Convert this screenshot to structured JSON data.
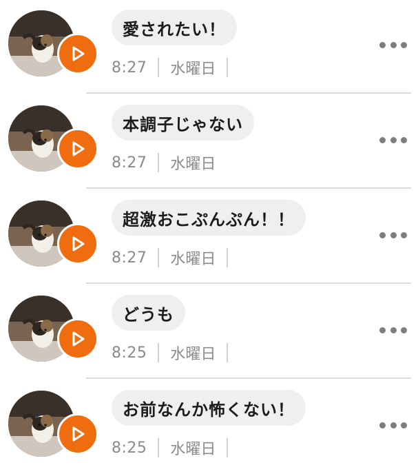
{
  "colors": {
    "accent": "#ef6c0f",
    "bubble_bg": "#efefef",
    "meta_text": "#8a8a8a",
    "divider": "#dadada"
  },
  "messages": [
    {
      "text": "愛されたい！",
      "time": "8:27",
      "day": "水曜日",
      "avatar_icon": "cat-photo-avatar",
      "play_icon": "play-icon",
      "more_icon": "more-dots-icon"
    },
    {
      "text": "本調子じゃない",
      "time": "8:27",
      "day": "水曜日",
      "avatar_icon": "cat-photo-avatar",
      "play_icon": "play-icon",
      "more_icon": "more-dots-icon"
    },
    {
      "text": "超激おこぷんぷん！！",
      "time": "8:27",
      "day": "水曜日",
      "avatar_icon": "cat-photo-avatar",
      "play_icon": "play-icon",
      "more_icon": "more-dots-icon"
    },
    {
      "text": "どうも",
      "time": "8:25",
      "day": "水曜日",
      "avatar_icon": "cat-photo-avatar",
      "play_icon": "play-icon",
      "more_icon": "more-dots-icon"
    },
    {
      "text": "お前なんか怖くない！",
      "time": "8:25",
      "day": "水曜日",
      "avatar_icon": "cat-photo-avatar",
      "play_icon": "play-icon",
      "more_icon": "more-dots-icon"
    }
  ]
}
